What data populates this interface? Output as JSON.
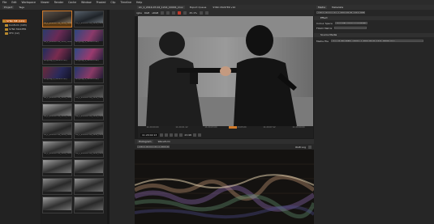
{
  "menubar": [
    "File",
    "Edit",
    "Workspace",
    "Viewer",
    "Render",
    "Cache",
    "Window",
    "Proxied",
    "Clip",
    "Timeline",
    "Help"
  ],
  "project_panel": {
    "tabs": [
      "Project",
      "Tags"
    ],
    "tree": [
      "SYNC ME (129)",
      "Conform (193)",
      "SYNC MASTER",
      "VFX (12)"
    ]
  },
  "thumbnails": [
    "A1_1_2014-07-02_1214_C0001.mov",
    "A1_1_2014-07-02_1214_C0002.mov",
    "A1_1_2014-07-02_1214_C0003.mov",
    "Amy(Digi_1_2014-07-02)",
    "Amy(Digi_1_2014-07-02)",
    "Amy(Digi_1_2014-07-02)",
    "Amy(Digi_1_2014-07-02)",
    "Amy(Digi_1_2014-07-02)",
    "A1_1_2014-07-02_1214_C0004.mov",
    "A1_1_2014-07-02_1214_C0005.mov",
    "A1_1_2014-07-02_1214_C0006.mov",
    "A1_1_2014-07-02_1214_C0007.mov",
    "A1_1_2014-07-02_1214_C0008.mov",
    "A1_1_2014-07-02_1214_C0009.mov",
    "A1_1_2014-07-02_1214_C0010.mov",
    "A1_1_2014-07-02_1214_C0011.mov"
  ],
  "viewer": {
    "tabs": [
      "A1_1_2014-07-02_1214_C0001_mov",
      "Export Queue",
      "SYNC MASTER v10"
    ],
    "toolbar": {
      "colorspace": "rgba",
      "channel": "RGB",
      "view": "sRGB",
      "zoom": "45.1%"
    },
    "timecodes": [
      "11:20:00:00",
      "11:20:01:12",
      "11:20:03:00",
      "11:20:05:00",
      "11:20:07:12",
      "11:20:09:00"
    ],
    "current_tc": "11:20:02:13",
    "fps": "23.98"
  },
  "scopes": {
    "tabs": [
      "Histogram",
      "Waveform"
    ],
    "source": "Active Viewer (A1_1_2014-07...)",
    "mode": "RGB Log"
  },
  "inspector": {
    "tabs": [
      "Media",
      "Metadata"
    ],
    "source_label": "Active Viewer (A1_1_2014-07-02_1214_C0001.mov)",
    "section_effect": "Effect",
    "colour_space_label": "Colour Space",
    "colour_space_value": "AlexaV3LogC(Linear)(sRGB)",
    "fcx_label": "FOACI Matrix",
    "section_source": "Source Media",
    "media_file_label": "Media File",
    "media_file_value": "/sou 11-NO_SYNC_v10/A1_1_2014-07-02_1214_C0001.mov"
  },
  "colors": {
    "accent": "#d07a2a",
    "background": "#1b1b1b",
    "panel": "#242424"
  }
}
